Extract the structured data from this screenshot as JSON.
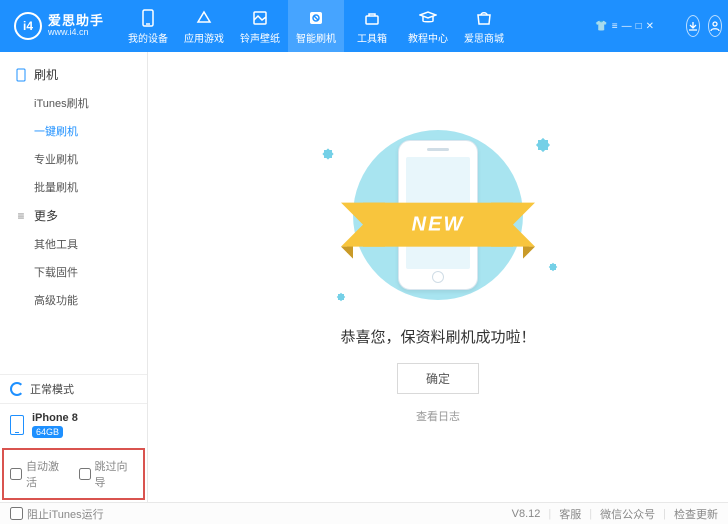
{
  "brand": {
    "mark": "i4",
    "title": "爱思助手",
    "url": "www.i4.cn"
  },
  "tabs": [
    {
      "label": "我的设备"
    },
    {
      "label": "应用游戏"
    },
    {
      "label": "铃声壁纸"
    },
    {
      "label": "智能刷机"
    },
    {
      "label": "工具箱"
    },
    {
      "label": "教程中心"
    },
    {
      "label": "爱思商城"
    }
  ],
  "sidebar": {
    "cat1": "刷机",
    "items1": [
      "iTunes刷机",
      "一键刷机",
      "专业刷机",
      "批量刷机"
    ],
    "cat2": "更多",
    "items2": [
      "其他工具",
      "下载固件",
      "高级功能"
    ],
    "mode": "正常模式",
    "device": {
      "name": "iPhone 8",
      "storage": "64GB"
    },
    "options": {
      "auto_activate": "自动激活",
      "skip_guide": "跳过向导"
    }
  },
  "main": {
    "ribbon": "NEW",
    "message": "恭喜您，保资料刷机成功啦！",
    "ok": "确定",
    "view_log": "查看日志"
  },
  "footer": {
    "block_itunes": "阻止iTunes运行",
    "version": "V8.12",
    "links": [
      "客服",
      "微信公众号",
      "检查更新"
    ]
  }
}
